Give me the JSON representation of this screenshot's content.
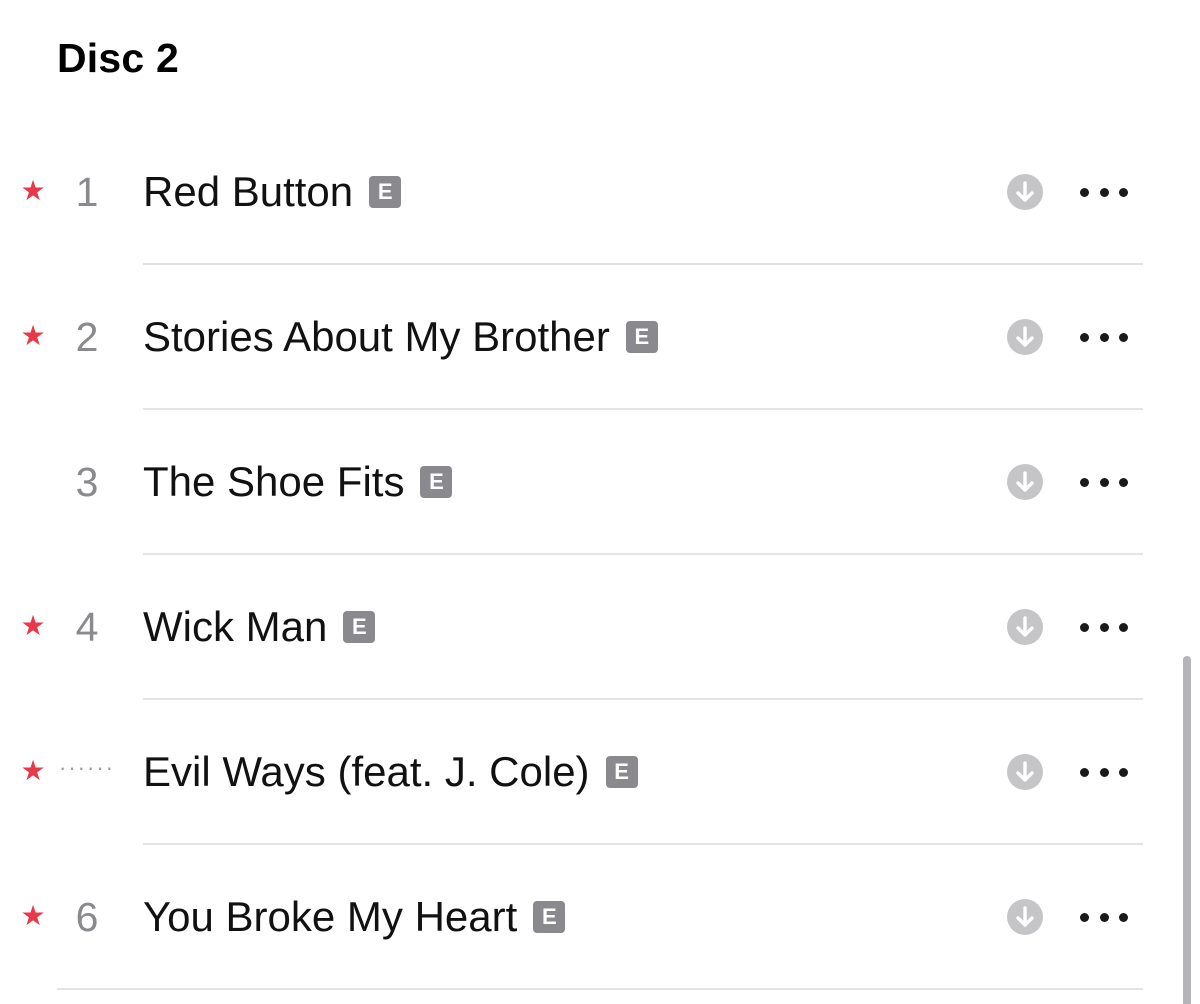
{
  "disc": {
    "title": "Disc 2"
  },
  "tracks": [
    {
      "number": "1",
      "title": "Red Button",
      "favorited": true,
      "explicit": true
    },
    {
      "number": "2",
      "title": "Stories About My Brother",
      "favorited": true,
      "explicit": true
    },
    {
      "number": "3",
      "title": "The Shoe Fits",
      "favorited": false,
      "explicit": true
    },
    {
      "number": "4",
      "title": "Wick Man",
      "favorited": true,
      "explicit": true
    },
    {
      "number": "",
      "title": "Evil Ways (feat. J. Cole)",
      "favorited": true,
      "explicit": true,
      "now_playing": true
    },
    {
      "number": "6",
      "title": "You Broke My Heart",
      "favorited": true,
      "explicit": true
    }
  ],
  "labels": {
    "explicit_badge": "E",
    "favorite_icon": "star-icon",
    "download_icon": "download-icon",
    "more_icon": "more-options-icon",
    "now_playing_indicator": "······"
  },
  "colors": {
    "favorite_star": "#e8394a",
    "explicit_badge": "#8a8a8e",
    "download_circle": "#c5c5c7"
  }
}
